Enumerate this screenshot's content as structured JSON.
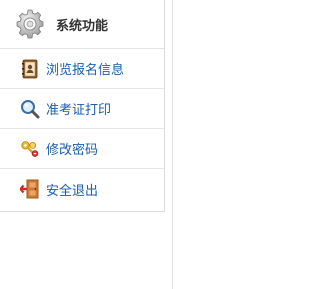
{
  "sidebar": {
    "title": "系统功能",
    "title_icon": "gear-icon",
    "items": [
      {
        "label": "浏览报名信息",
        "icon": "address-book-icon"
      },
      {
        "label": "准考证打印",
        "icon": "magnifier-icon"
      },
      {
        "label": "修改密码",
        "icon": "keys-icon"
      },
      {
        "label": "安全退出",
        "icon": "exit-door-icon"
      }
    ]
  },
  "colors": {
    "link": "#1a5ea8",
    "title": "#333333",
    "border": "#dcdcdc"
  }
}
